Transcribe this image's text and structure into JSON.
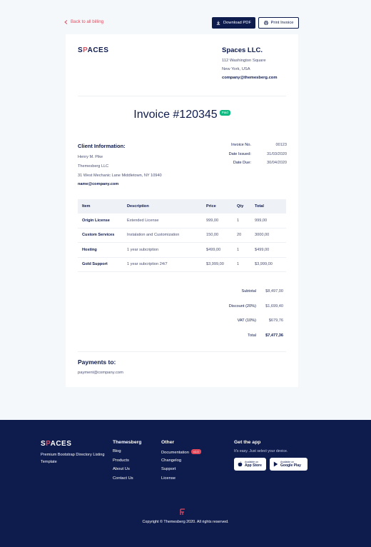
{
  "nav": {
    "back": "Back to all billing",
    "download": "Download PDF",
    "print": "Print Invoice"
  },
  "brand": {
    "logo_pre": "S",
    "logo_a": "P",
    "logo_post": "ACES"
  },
  "company": {
    "name": "Spaces LLC.",
    "address1": "112 Washington Square",
    "address2": "New York, USA",
    "email": "company@themesberg.com"
  },
  "invoice": {
    "title": "Invoice #120345",
    "status": "Paid"
  },
  "client": {
    "heading": "Client Information:",
    "name": "Henry M. Pike",
    "company": "Themesberg LLC",
    "address": "31 West Mechanic Lane Middletown, NY 10940",
    "email": "name@company.com"
  },
  "meta": [
    {
      "k": "Invoice No.",
      "v": "00123"
    },
    {
      "k": "Date Issued:",
      "v": "31/03/2020"
    },
    {
      "k": "Date Due:",
      "v": "30/04/2020"
    }
  ],
  "table": {
    "headers": [
      "Item",
      "Description",
      "Price",
      "Qty",
      "Total"
    ],
    "rows": [
      [
        "Origin License",
        "Extended License",
        "999,00",
        "1",
        "999,00"
      ],
      [
        "Custom Services",
        "Instalation and Customization",
        "150,00",
        "20",
        "3000,00"
      ],
      [
        "Hosting",
        "1 year subcription",
        "$499,00",
        "1",
        "$499,00"
      ],
      [
        "Gold Support",
        "1 year subcription 24/7",
        "$3,999,00",
        "1",
        "$3,999,00"
      ]
    ]
  },
  "totals": [
    {
      "k": "Subtotal",
      "v": "$8,497,00"
    },
    {
      "k": "Discount (20%)",
      "v": "$1,699,40"
    },
    {
      "k": "VAT (10%)",
      "v": "$679,76"
    },
    {
      "k": "Total",
      "v": "$7,477,36"
    }
  ],
  "payments": {
    "heading": "Payments to:",
    "email": "payment@company.com"
  },
  "footer": {
    "tagline": "Premium Bootstrap Directory Listing Template",
    "col1": {
      "heading": "Themesberg",
      "links": [
        "Blog",
        "Products",
        "About Us",
        "Contact Us"
      ]
    },
    "col2": {
      "heading": "Other",
      "links": [
        "Documentation",
        "Changelog",
        "Support",
        "License"
      ],
      "badge": "v1.0"
    },
    "app": {
      "heading": "Get the app",
      "note": "It's easy. Just select your device.",
      "appstore_small": "Available on",
      "appstore_big": "App Store",
      "gplay_small": "Available on",
      "gplay_big": "Google Play"
    },
    "copyright": "Copyright © Themesberg 2020. All rights reserved."
  },
  "colors": {
    "navy": "#0e1b4d",
    "accent": "#e4485b",
    "paid": "#10b981"
  },
  "icons": [
    "chevron-left-icon",
    "download-icon",
    "print-icon",
    "apple-icon",
    "google-play-icon",
    "brand-mark-icon"
  ]
}
